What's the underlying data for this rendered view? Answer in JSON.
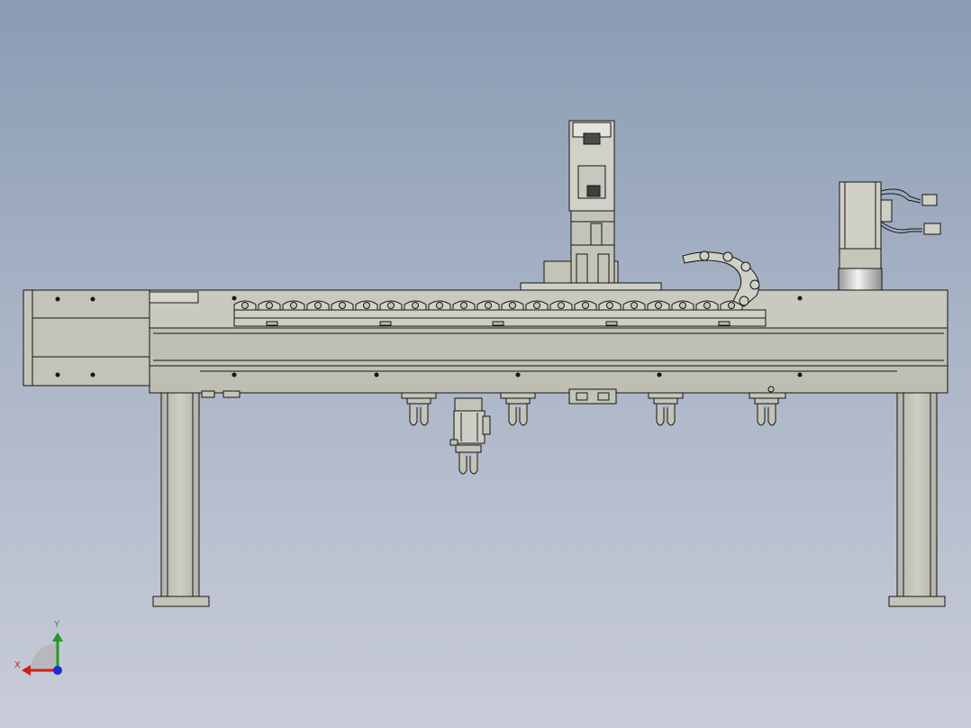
{
  "viewport": {
    "background_top": "#8a9bb2",
    "background_bottom": "#c9ccd8"
  },
  "colors": {
    "part_fill": "#c4c3b8",
    "part_fill_light": "#d6d5cc",
    "part_fill_dark": "#a9a89e",
    "edge": "#151515",
    "motor_cylinder_light": "#f2f2f2",
    "motor_cylinder_dark": "#8e8e8e"
  },
  "assembly": {
    "gripper_stations": 5,
    "drag_chain_links": 21
  },
  "triad": {
    "y_label": "Y",
    "x_label": "X",
    "y_color": "#1e9b24",
    "x_color": "#d0201c",
    "z_color": "#1a2fd0"
  }
}
